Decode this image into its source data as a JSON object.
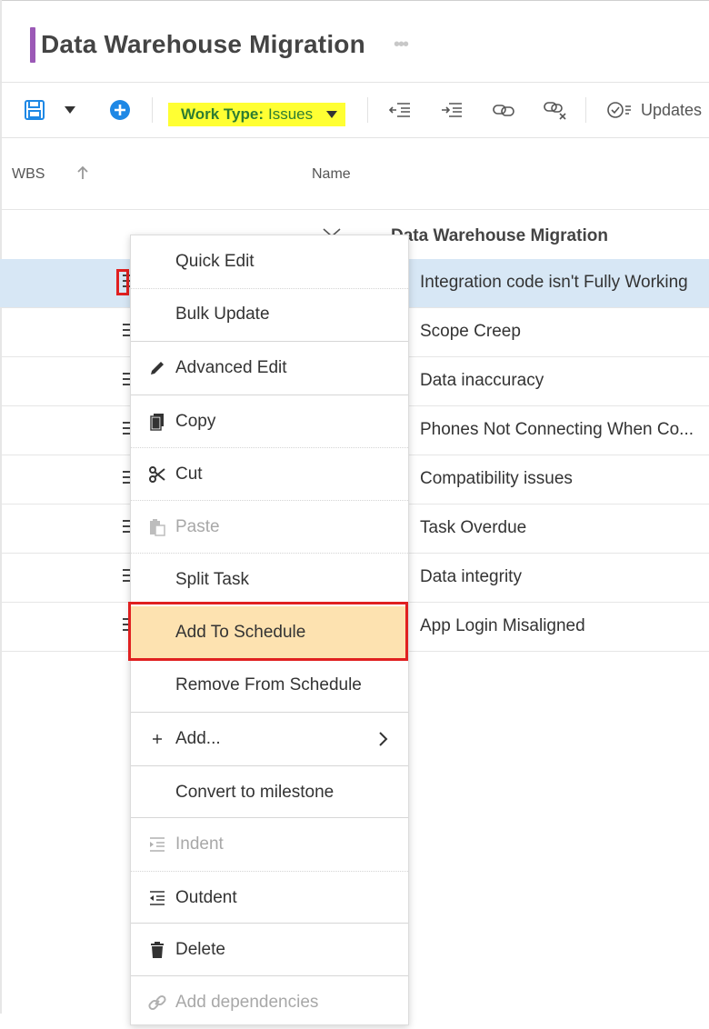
{
  "page": {
    "title": "Data Warehouse Migration",
    "more": "•••"
  },
  "toolbar": {
    "worktype_key": "Work Type:",
    "worktype_value": "Issues",
    "updates": "Updates"
  },
  "columns": {
    "wbs": "WBS",
    "name": "Name"
  },
  "parent_row": {
    "name": "Data Warehouse Migration"
  },
  "rows": [
    {
      "name": "Integration code isn't Fully Working",
      "selected": true
    },
    {
      "name": "Scope Creep"
    },
    {
      "name": "Data inaccuracy"
    },
    {
      "name": "Phones Not Connecting When Co..."
    },
    {
      "name": "Compatibility issues"
    },
    {
      "name": "Task Overdue"
    },
    {
      "name": "Data integrity"
    },
    {
      "name": "App Login Misaligned"
    }
  ],
  "menu": {
    "quick_edit": "Quick Edit",
    "bulk_update": "Bulk Update",
    "advanced_edit": "Advanced Edit",
    "copy": "Copy",
    "cut": "Cut",
    "paste": "Paste",
    "split_task": "Split Task",
    "add_to_schedule": "Add To Schedule",
    "remove_from_schedule": "Remove From Schedule",
    "add": "Add...",
    "convert_to_milestone": "Convert to milestone",
    "indent": "Indent",
    "outdent": "Outdent",
    "delete": "Delete",
    "add_dependencies": "Add dependencies"
  },
  "colors": {
    "accent_purple": "#9b59b6",
    "primary_blue": "#1e88e5",
    "highlight_yellow": "#ffff33",
    "menu_highlight": "#fde2b0",
    "annotation_red": "#e02020",
    "selected_row": "#d7e7f5"
  },
  "icons": [
    "save-icon",
    "dropdown-caret-icon",
    "add-circle-icon",
    "outdent-icon",
    "indent-icon",
    "link-icon",
    "unlink-icon",
    "updates-check-icon",
    "sort-up-icon",
    "chevron-down-icon",
    "drag-handle-icon",
    "pencil-icon",
    "copy-icon",
    "scissors-icon",
    "paste-icon",
    "plus-icon",
    "chevron-right-icon",
    "trash-icon"
  ]
}
